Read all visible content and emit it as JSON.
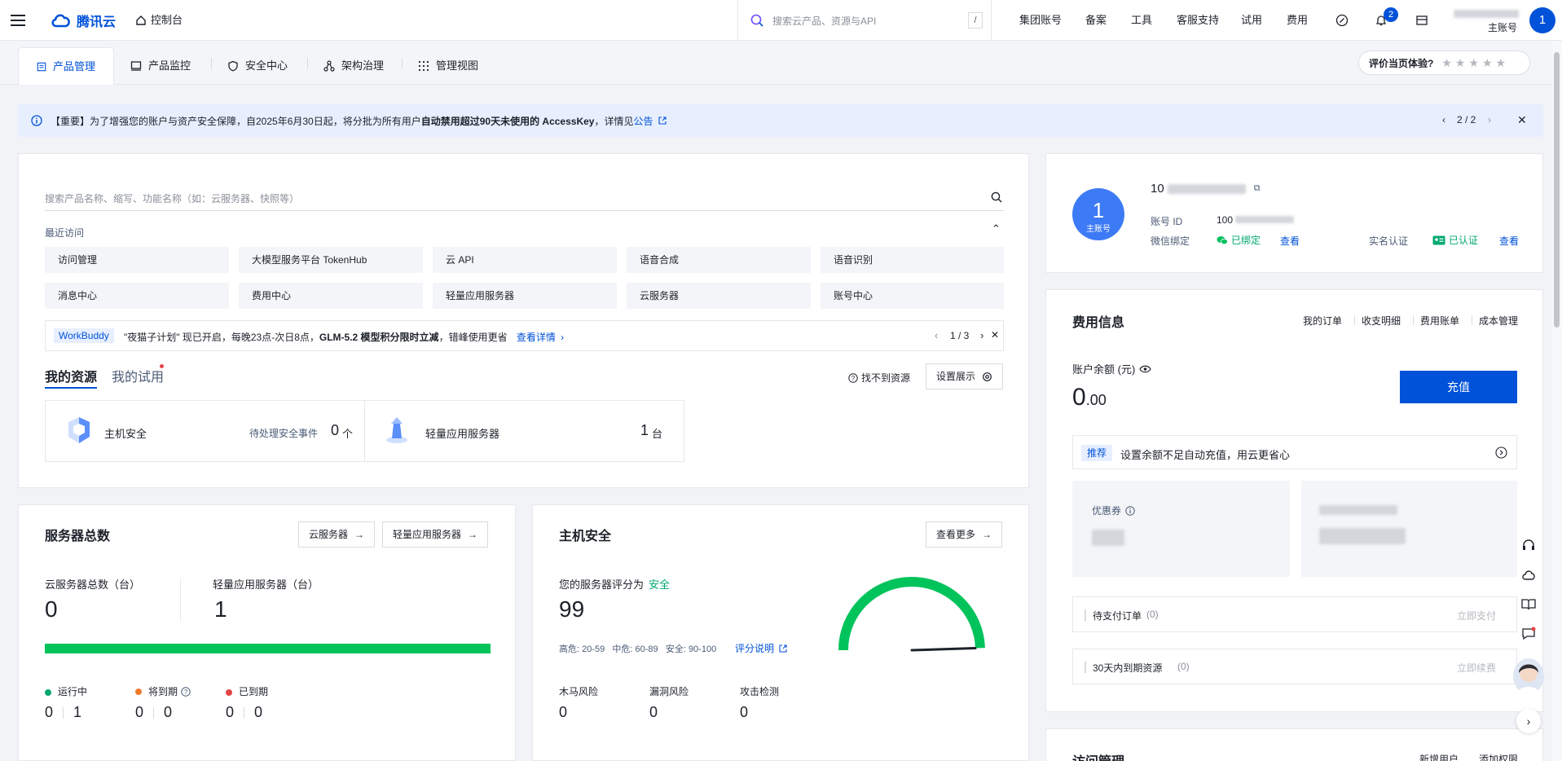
{
  "topbar": {
    "brand": "腾讯云",
    "console": "控制台",
    "search_placeholder": "搜索云产品、资源与API",
    "search_shortcut": "/",
    "nav": [
      "集团账号",
      "备案",
      "工具",
      "客服支持",
      "试用",
      "费用"
    ],
    "notification_count": "2",
    "account_role": "主账号",
    "avatar_text": "1"
  },
  "tabs": [
    "产品管理",
    "产品监控",
    "安全中心",
    "架构治理",
    "管理视图"
  ],
  "rating": {
    "label": "评价当页体验?",
    "stars": 5
  },
  "notice": {
    "prefix": "【重要】为了增强您的账户与资产安全保障，自2025年6月30日起，将分批为所有用户",
    "bold": "自动禁用超过90天未使用的 AccessKey",
    "suffix": "，详情见",
    "link": "公告",
    "pager": "2 / 2"
  },
  "product_search": {
    "placeholder": "搜索产品名称、缩写、功能名称（如：云服务器、快照等）"
  },
  "recent": {
    "title": "最近访问",
    "items": [
      "访问管理",
      "大模型服务平台 TokenHub",
      "云 API",
      "语音合成",
      "语音识别",
      "消息中心",
      "费用中心",
      "轻量应用服务器",
      "云服务器",
      "账号中心"
    ]
  },
  "promo": {
    "tag": "WorkBuddy",
    "text_a": "\"夜猫子计划\" 现已开启，每晚23点-次日8点，",
    "text_bold": "GLM-5.2 模型积分限时立减",
    "text_b": "，错峰使用更省",
    "link": "查看详情",
    "pager": "1 / 3"
  },
  "resources": {
    "tab_mine": "我的资源",
    "tab_trial": "我的试用",
    "not_found": "找不到资源",
    "settings": "设置展示",
    "items": [
      {
        "name": "主机安全",
        "sub": "待处理安全事件",
        "value": "0",
        "unit": "个"
      },
      {
        "name": "轻量应用服务器",
        "sub": "",
        "value": "1",
        "unit": "台"
      }
    ]
  },
  "servers": {
    "title": "服务器总数",
    "btn_cvm": "云服务器",
    "btn_lh": "轻量应用服务器",
    "cvm_label": "云服务器总数（台）",
    "cvm_value": "0",
    "lh_label": "轻量应用服务器（台）",
    "lh_value": "1",
    "bar_fraction": 1.0,
    "statuses": [
      {
        "label": "运行中",
        "color": "#00a870",
        "a": "0",
        "b": "1"
      },
      {
        "label": "将到期",
        "color": "#ed7b2f",
        "a": "0",
        "b": "0"
      },
      {
        "label": "已到期",
        "color": "#e54545",
        "a": "0",
        "b": "0"
      }
    ]
  },
  "host_security": {
    "title": "主机安全",
    "more": "查看更多",
    "score_label": "您的服务器评分为",
    "score_level": "安全",
    "score": "99",
    "ranges": "高危: 20-59   中危: 60-89   安全: 90-100",
    "explain": "评分说明",
    "gauge_fraction": 0.99,
    "risks": [
      {
        "label": "木马风险",
        "value": "0"
      },
      {
        "label": "漏洞风险",
        "value": "0"
      },
      {
        "label": "攻击检测",
        "value": "0"
      }
    ]
  },
  "account": {
    "avatar_text": "1",
    "avatar_role": "主账号",
    "name_prefix": "10",
    "id_label": "账号 ID",
    "id_prefix": "100",
    "wechat_label": "微信绑定",
    "wechat_status": "已绑定",
    "view": "查看",
    "realname_label": "实名认证",
    "realname_status": "已认证"
  },
  "billing": {
    "title": "费用信息",
    "links": [
      "我的订单",
      "收支明细",
      "费用账单",
      "成本管理"
    ],
    "balance_label": "账户余额 (元)",
    "balance_int": "0",
    "balance_dec": ".00",
    "recharge": "充值",
    "recommend_tag": "推荐",
    "recommend_text": "设置余额不足自动充值，用云更省心",
    "coupon_label": "优惠券",
    "pending_orders": "待支付订单",
    "pending_count": "(0)",
    "pay_now": "立即支付",
    "expiring": "30天内到期资源",
    "expiring_count": "(0)",
    "renew_now": "立即续费"
  },
  "access": {
    "title": "访问管理",
    "links": [
      "新增用户",
      "添加权限"
    ]
  },
  "colors": {
    "primary": "#0052d9",
    "success": "#00a870",
    "warning": "#ed7b2f",
    "danger": "#e54545"
  }
}
